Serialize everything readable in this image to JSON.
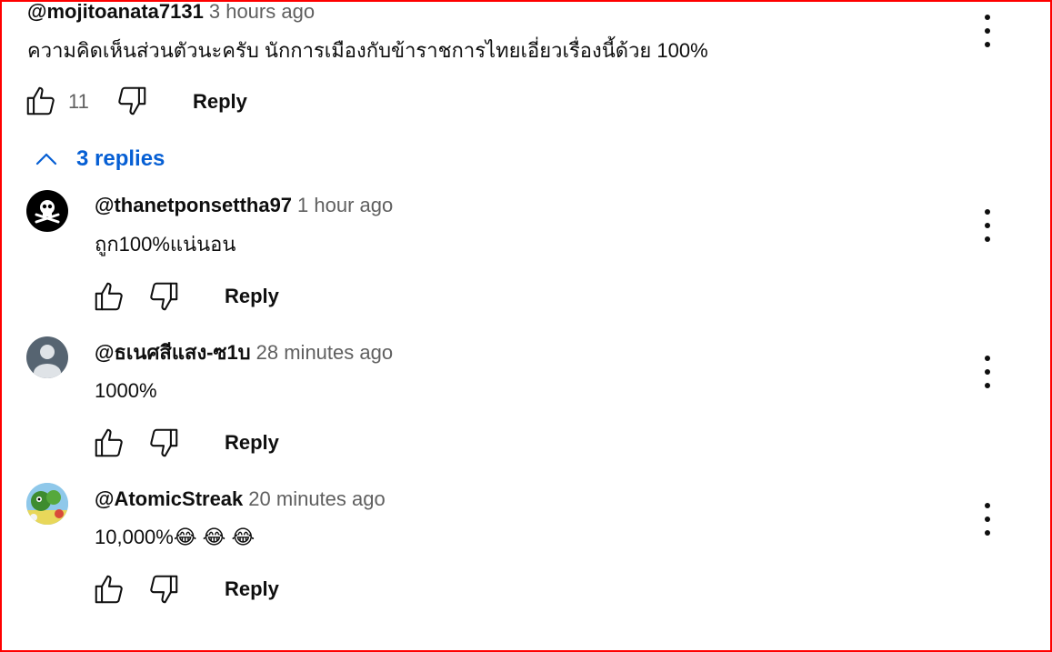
{
  "top_comment": {
    "author": "@mojitoanata7131",
    "time": "3 hours ago",
    "text": "ความคิดเห็นส่วนตัวนะครับ นักการเมืองกับข้าราชการไทยเอี่ยวเรื่องนี้ด้วย 100%",
    "likes": "11",
    "reply_label": "Reply"
  },
  "replies_toggle": {
    "label": "3 replies",
    "icon": "chevron-up-icon"
  },
  "replies": [
    {
      "author": "@thanetponsettha97",
      "time": "1 hour ago",
      "text": "ถูก100%แน่นอน",
      "reply_label": "Reply",
      "avatar": "skull-crossbones-avatar"
    },
    {
      "author": "@ธเนศสีแสง-ซ1บ",
      "time": "28 minutes ago",
      "text": "1000%",
      "reply_label": "Reply",
      "avatar": "default-person-avatar"
    },
    {
      "author": "@AtomicStreak",
      "time": "20 minutes ago",
      "text": "10,000%😂 😂 😂",
      "reply_label": "Reply",
      "avatar": "cartoon-avatar"
    }
  ],
  "colors": {
    "link": "#065fd4",
    "muted": "#606060",
    "frame": "#ff0000"
  }
}
